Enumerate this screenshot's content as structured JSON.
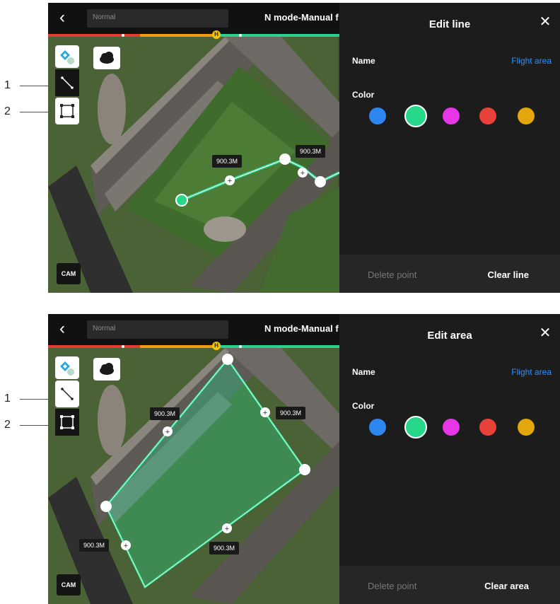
{
  "callouts": [
    "1",
    "2",
    "1",
    "2"
  ],
  "screens": [
    {
      "back_glyph": "‹",
      "mode_placeholder": "Normal",
      "flight_mode": "N mode-Manual f",
      "home_marker": "H",
      "cam_label": "CAM",
      "distance_labels": [
        "900.3M",
        "900.3M"
      ],
      "panel": {
        "title": "Edit line",
        "close_glyph": "✕",
        "name_label": "Name",
        "name_value": "Flight area",
        "color_label": "Color",
        "colors": [
          "#2e86f0",
          "#27d88a",
          "#e837e8",
          "#e8413a",
          "#e2a70c"
        ],
        "selected_color": "#27d88a",
        "delete_label": "Delete point",
        "clear_label": "Clear line"
      }
    },
    {
      "back_glyph": "‹",
      "mode_placeholder": "Normal",
      "flight_mode": "N mode-Manual f",
      "home_marker": "H",
      "cam_label": "CAM",
      "distance_labels": [
        "900.3M",
        "900.3M",
        "900.3M",
        "900.3M"
      ],
      "panel": {
        "title": "Edit area",
        "close_glyph": "✕",
        "name_label": "Name",
        "name_value": "Flight area",
        "color_label": "Color",
        "colors": [
          "#2e86f0",
          "#27d88a",
          "#e837e8",
          "#e8413a",
          "#e2a70c"
        ],
        "selected_color": "#27d88a",
        "delete_label": "Delete point",
        "clear_label": "Clear area"
      }
    }
  ],
  "icons": {
    "map_layer": "map-layer-icon",
    "cloud": "cloud-icon",
    "line_tool": "line-tool-icon",
    "area_tool": "area-tool-icon",
    "back": "chevron-left-icon",
    "close": "close-icon"
  },
  "accent": "#2e8fff",
  "path_color": "#27d88a"
}
